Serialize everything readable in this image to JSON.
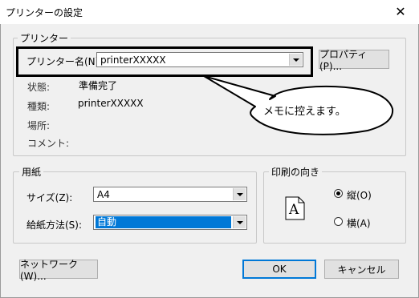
{
  "window": {
    "title": "プリンターの設定",
    "close_glyph": "✕"
  },
  "printer_group": {
    "legend": "プリンター",
    "name_label": "プリンター名(N):",
    "name_value": "printerXXXXX",
    "properties_button": "プロパティ(P)...",
    "status_label": "状態:",
    "status_value": "準備完了",
    "type_label": "種類:",
    "type_value": "printerXXXXX",
    "location_label": "場所:",
    "comment_label": "コメント:"
  },
  "callout": {
    "text": "メモに控えます。"
  },
  "paper_group": {
    "legend": "用紙",
    "size_label": "サイズ(Z):",
    "size_value": "A4",
    "source_label": "給紙方法(S):",
    "source_value": "自動"
  },
  "orientation_group": {
    "legend": "印刷の向き",
    "portrait_label": "縦(O)",
    "landscape_label": "横(A)",
    "selected": "portrait",
    "preview_letter": "A"
  },
  "footer": {
    "network_button": "ネットワーク(W)...",
    "ok_button": "OK",
    "cancel_button": "キャンセル"
  }
}
